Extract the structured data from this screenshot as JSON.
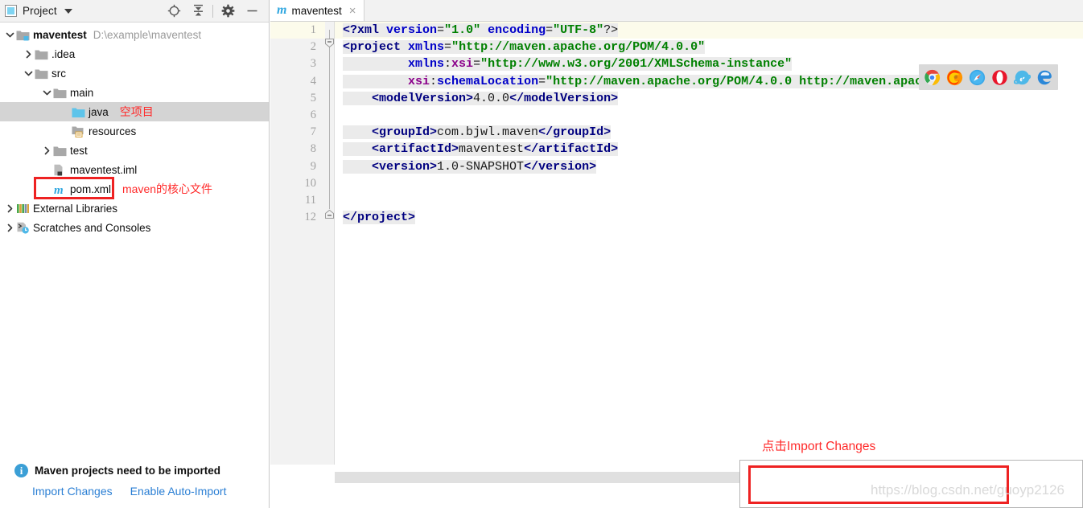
{
  "project_panel": {
    "title": "Project",
    "icons": {
      "window_icon": "project-window-icon",
      "dropdown": "chevron-down-icon",
      "locate": "locate-target-icon",
      "collapse_all": "collapse-all-icon",
      "settings": "gear-icon",
      "hide": "minimize-icon"
    },
    "tree": [
      {
        "label": "maventest",
        "path_suffix": "D:\\example\\maventest",
        "icon": "module-folder-icon",
        "arrow": "expanded",
        "indent": 0,
        "bold": true,
        "selected": false,
        "annotation": ""
      },
      {
        "label": ".idea",
        "path_suffix": "",
        "icon": "folder-icon",
        "arrow": "collapsed",
        "indent": 1,
        "bold": false,
        "selected": false,
        "annotation": ""
      },
      {
        "label": "src",
        "path_suffix": "",
        "icon": "folder-icon",
        "arrow": "expanded",
        "indent": 1,
        "bold": false,
        "selected": false,
        "annotation": ""
      },
      {
        "label": "main",
        "path_suffix": "",
        "icon": "folder-icon",
        "arrow": "expanded",
        "indent": 2,
        "bold": false,
        "selected": false,
        "annotation": ""
      },
      {
        "label": "java",
        "path_suffix": "",
        "icon": "sources-root-folder-icon",
        "arrow": "none",
        "indent": 3,
        "bold": false,
        "selected": true,
        "annotation": "空项目"
      },
      {
        "label": "resources",
        "path_suffix": "",
        "icon": "resources-root-folder-icon",
        "arrow": "none",
        "indent": 3,
        "bold": false,
        "selected": false,
        "annotation": ""
      },
      {
        "label": "test",
        "path_suffix": "",
        "icon": "folder-icon",
        "arrow": "collapsed",
        "indent": 2,
        "bold": false,
        "selected": false,
        "annotation": ""
      },
      {
        "label": "maventest.iml",
        "path_suffix": "",
        "icon": "iml-file-icon",
        "arrow": "none",
        "indent": 2,
        "bold": false,
        "selected": false,
        "annotation": ""
      },
      {
        "label": "pom.xml",
        "path_suffix": "",
        "icon": "maven-pom-icon",
        "arrow": "none",
        "indent": 2,
        "bold": false,
        "selected": false,
        "annotation": "maven的核心文件"
      },
      {
        "label": "External Libraries",
        "path_suffix": "",
        "icon": "libraries-icon",
        "arrow": "collapsed",
        "indent": 0,
        "bold": false,
        "selected": false,
        "annotation": ""
      },
      {
        "label": "Scratches and Consoles",
        "path_suffix": "",
        "icon": "scratches-icon",
        "arrow": "collapsed",
        "indent": 0,
        "bold": false,
        "selected": false,
        "annotation": ""
      }
    ]
  },
  "editor": {
    "tab": {
      "label": "maventest",
      "icon": "maven-m-icon",
      "close": "×"
    },
    "line_numbers": [
      "1",
      "2",
      "3",
      "4",
      "5",
      "6",
      "7",
      "8",
      "9",
      "10",
      "11",
      "12"
    ],
    "current_line": 1,
    "browser_icons": [
      "chrome-icon",
      "firefox-icon",
      "safari-icon",
      "opera-icon",
      "internet-explorer-icon",
      "edge-icon"
    ],
    "code_lines": [
      {
        "n": 1,
        "tokens": [
          {
            "t": "<?",
            "c": "tag"
          },
          {
            "t": "xml",
            "c": "tag"
          },
          {
            "t": " ",
            "c": "plain"
          },
          {
            "t": "version",
            "c": "attr"
          },
          {
            "t": "=",
            "c": "plain"
          },
          {
            "t": "\"1.0\"",
            "c": "val"
          },
          {
            "t": " ",
            "c": "plain"
          },
          {
            "t": "encoding",
            "c": "attr"
          },
          {
            "t": "=",
            "c": "plain"
          },
          {
            "t": "\"UTF-8\"",
            "c": "val"
          },
          {
            "t": "?>",
            "c": "plain"
          }
        ]
      },
      {
        "n": 2,
        "tokens": [
          {
            "t": "<project",
            "c": "tag"
          },
          {
            "t": " ",
            "c": "plain"
          },
          {
            "t": "xmlns",
            "c": "attr"
          },
          {
            "t": "=",
            "c": "plain"
          },
          {
            "t": "\"http://maven.apache.org/POM/4.0.0\"",
            "c": "val"
          }
        ]
      },
      {
        "n": 3,
        "tokens": [
          {
            "t": "         ",
            "c": "plain"
          },
          {
            "t": "xmlns",
            "c": "attr"
          },
          {
            "t": ":",
            "c": "plain"
          },
          {
            "t": "xsi",
            "c": "ns"
          },
          {
            "t": "=",
            "c": "plain"
          },
          {
            "t": "\"http://www.w3.org/2001/XMLSchema-instance\"",
            "c": "val"
          }
        ]
      },
      {
        "n": 4,
        "tokens": [
          {
            "t": "         ",
            "c": "plain"
          },
          {
            "t": "xsi",
            "c": "ns"
          },
          {
            "t": ":",
            "c": "plain"
          },
          {
            "t": "schemaLocation",
            "c": "attr"
          },
          {
            "t": "=",
            "c": "plain"
          },
          {
            "t": "\"http://maven.apache.org/POM/4.0.0 http://maven.apache.or",
            "c": "val"
          }
        ]
      },
      {
        "n": 5,
        "tokens": [
          {
            "t": "    ",
            "c": "plain"
          },
          {
            "t": "<modelVersion>",
            "c": "tag"
          },
          {
            "t": "4.0.0",
            "c": "plain"
          },
          {
            "t": "</modelVersion>",
            "c": "tag"
          }
        ]
      },
      {
        "n": 6,
        "tokens": []
      },
      {
        "n": 7,
        "tokens": [
          {
            "t": "    ",
            "c": "plain"
          },
          {
            "t": "<groupId>",
            "c": "tag"
          },
          {
            "t": "com.bjwl.maven",
            "c": "plain"
          },
          {
            "t": "</groupId>",
            "c": "tag"
          }
        ]
      },
      {
        "n": 8,
        "tokens": [
          {
            "t": "    ",
            "c": "plain"
          },
          {
            "t": "<artifactId>",
            "c": "tag"
          },
          {
            "t": "maventest",
            "c": "plain"
          },
          {
            "t": "</artifactId>",
            "c": "tag"
          }
        ]
      },
      {
        "n": 9,
        "tokens": [
          {
            "t": "    ",
            "c": "plain"
          },
          {
            "t": "<version>",
            "c": "tag"
          },
          {
            "t": "1.0-SNAPSHOT",
            "c": "plain"
          },
          {
            "t": "</version>",
            "c": "tag"
          }
        ]
      },
      {
        "n": 10,
        "tokens": []
      },
      {
        "n": 11,
        "tokens": []
      },
      {
        "n": 12,
        "tokens": [
          {
            "t": "</project>",
            "c": "tag"
          }
        ]
      }
    ]
  },
  "notification": {
    "annotation": "点击Import Changes",
    "icon": "info-icon",
    "title": "Maven projects need to be imported",
    "links": [
      {
        "label": "Import Changes"
      },
      {
        "label": "Enable Auto-Import"
      }
    ]
  },
  "watermark": "https://blog.csdn.net/guoyp2126",
  "colors": {
    "annotation_red": "#ff2a2a",
    "link_blue": "#2b7fd4",
    "xml_tag": "#000080",
    "xml_attr": "#0000c8",
    "xml_value": "#008000",
    "xml_ns": "#8b008b",
    "selection_gray": "#d4d4d4"
  }
}
